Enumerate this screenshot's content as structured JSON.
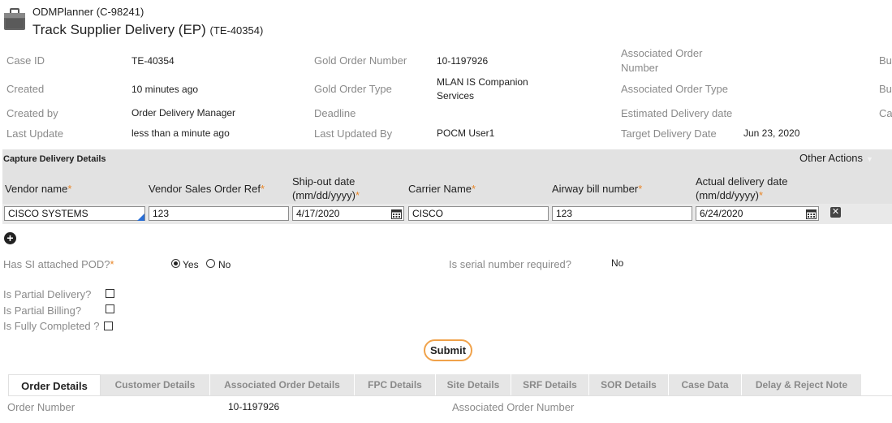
{
  "header": {
    "app_name": "ODMPlanner (C-98241)",
    "case_title": "Track Supplier Delivery (EP)",
    "case_id": "(TE-40354)"
  },
  "summary": {
    "case_id_label": "Case ID",
    "case_id_value": "TE-40354",
    "created_label": "Created",
    "created_value": "10 minutes ago",
    "created_by_label": "Created by",
    "created_by_value": "Order Delivery Manager",
    "last_update_label": "Last Update",
    "last_update_value": "less than a minute ago",
    "gold_order_number_label": "Gold Order Number",
    "gold_order_number_value": "10-1197926",
    "gold_order_type_label": "Gold Order Type",
    "gold_order_type_value_line1": "MLAN IS Companion",
    "gold_order_type_value_line2": "Services",
    "deadline_label": "Deadline",
    "last_updated_by_label": "Last Updated By",
    "last_updated_by_value": "POCM User1",
    "assoc_order_number_label_line1": "Associated Order",
    "assoc_order_number_label_line2": "Number",
    "assoc_order_type_label": "Associated Order Type",
    "est_delivery_label": "Estimated Delivery date",
    "target_delivery_label": "Target Delivery Date",
    "target_delivery_value": "Jun 23, 2020",
    "clipped_1": "Bu",
    "clipped_2": "Bu",
    "clipped_3": "Ca"
  },
  "capture": {
    "title": "Capture Delivery Details",
    "other_actions": "Other Actions",
    "columns": {
      "vendor_name": "Vendor name",
      "vendor_sales_order_ref": "Vendor Sales Order Ref",
      "ship_out_line1": "Ship-out date",
      "ship_out_line2": "(mm/dd/yyyy)",
      "carrier_name": "Carrier Name",
      "airway_bill": "Airway bill number",
      "actual_delivery_line1": "Actual delivery date",
      "actual_delivery_line2": "(mm/dd/yyyy)"
    },
    "required_mark": "*",
    "row": {
      "vendor_name": "CISCO SYSTEMS",
      "vendor_sales_order_ref": "123",
      "ship_out_date": "4/17/2020",
      "carrier_name": "CISCO",
      "airway_bill": "123",
      "actual_delivery_date": "6/24/2020"
    }
  },
  "form": {
    "pod_label": "Has SI attached POD?",
    "pod_yes": "Yes",
    "pod_no": "No",
    "serial_label": "Is serial number required?",
    "serial_value": "No",
    "partial_delivery_label": "Is Partial Delivery?",
    "partial_billing_label": "Is Partial Billing?",
    "fully_completed_label": "Is Fully Completed ?",
    "submit": "Submit"
  },
  "tabs": [
    "Order Details",
    "Customer Details",
    "Associated Order Details",
    "FPC Details",
    "Site Details",
    "SRF Details",
    "SOR Details",
    "Case Data",
    "Delay & Reject Note"
  ],
  "order_details": {
    "order_number_label": "Order Number",
    "order_number_value": "10-1197926",
    "assoc_order_number_label": "Associated Order Number"
  },
  "colors": {
    "accent": "#e8872a",
    "section_bg": "#e2e2e2",
    "submit_border": "#f0a24a"
  }
}
